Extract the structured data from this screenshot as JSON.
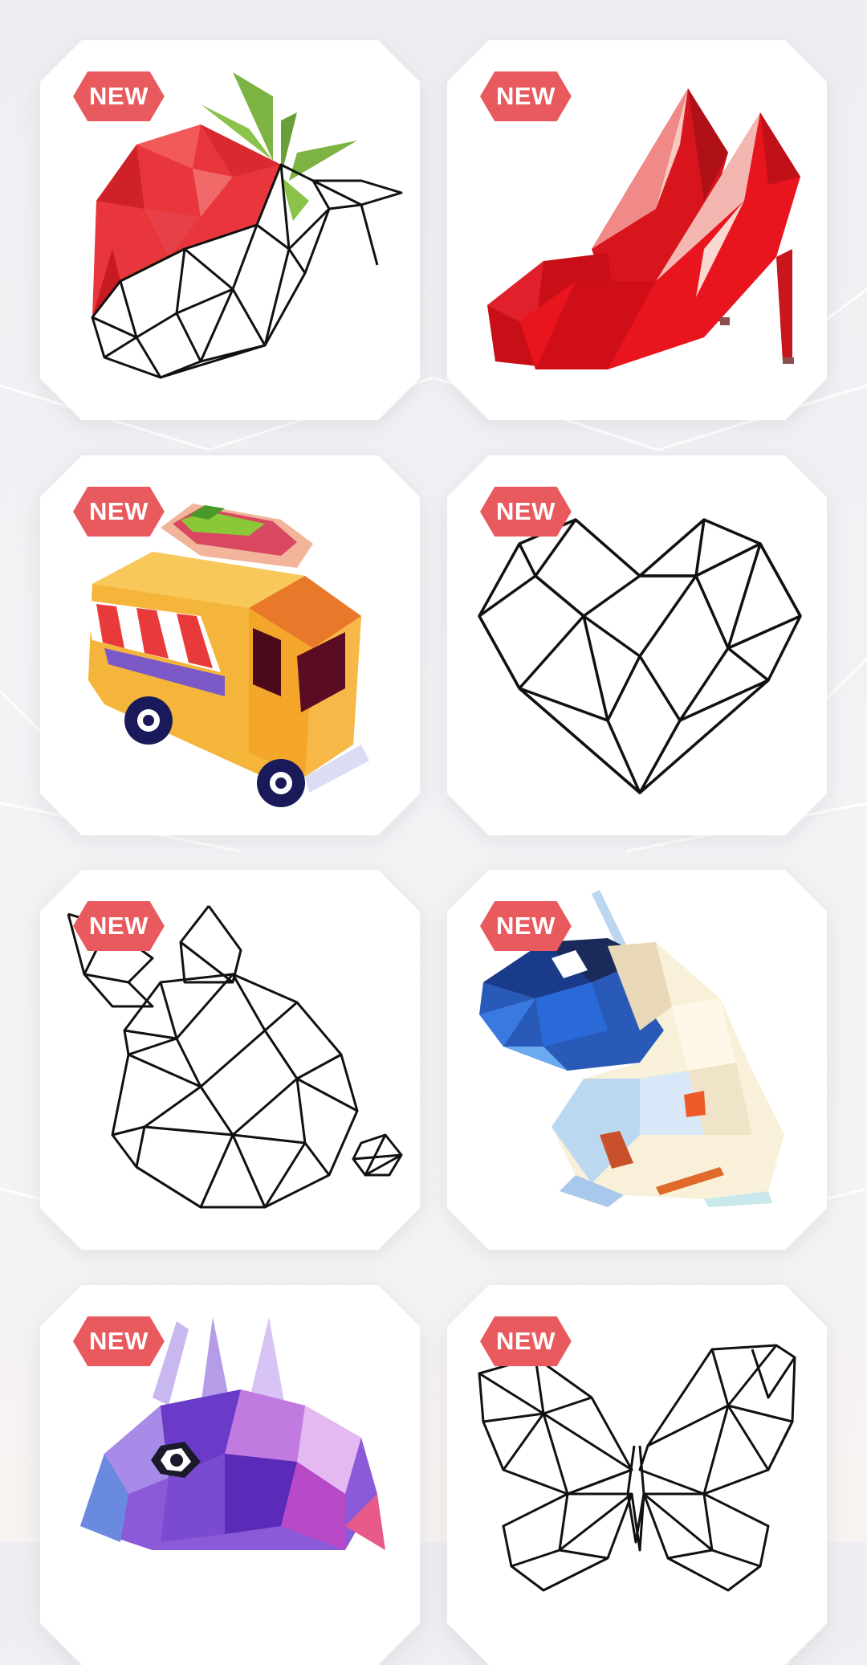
{
  "colors": {
    "badge": "#e85a5d",
    "card": "#ffffff",
    "background": "#f1f0f3"
  },
  "gallery": {
    "cards": [
      {
        "title_icon": "strawberry-icon",
        "badge": "NEW"
      },
      {
        "title_icon": "high-heels-icon",
        "badge": "NEW"
      },
      {
        "title_icon": "food-truck-icon",
        "badge": "NEW"
      },
      {
        "title_icon": "heart-icon",
        "badge": "NEW"
      },
      {
        "title_icon": "bunny-icon",
        "badge": "NEW"
      },
      {
        "title_icon": "astronaut-icon",
        "badge": "NEW"
      },
      {
        "title_icon": "chameleon-icon",
        "badge": "NEW"
      },
      {
        "title_icon": "butterfly-icon",
        "badge": "NEW"
      }
    ]
  }
}
